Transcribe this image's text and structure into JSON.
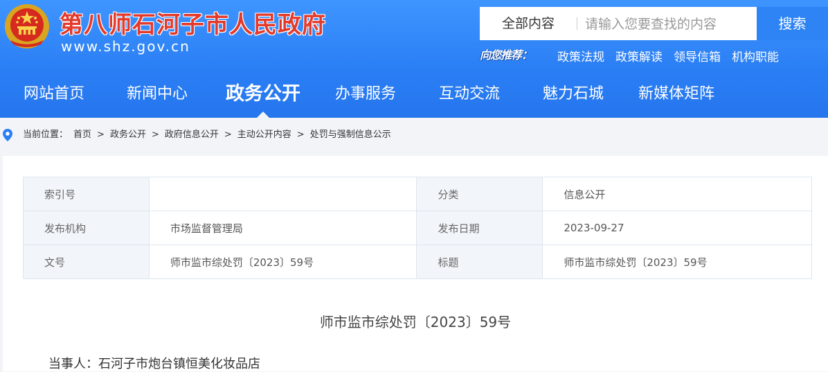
{
  "header": {
    "site_name": "第八师石河子市人民政府",
    "site_url": "www.shz.gov.cn",
    "search": {
      "scope": "全部内容",
      "placeholder": "请输入您要查找的内容",
      "button": "搜索"
    },
    "recommend_label": "向您推荐：",
    "quick_links": [
      "政策法规",
      "政策解读",
      "领导信箱",
      "机构职能"
    ]
  },
  "nav": {
    "items": [
      "网站首页",
      "新闻中心",
      "政务公开",
      "办事服务",
      "互动交流",
      "魅力石城",
      "新媒体矩阵"
    ],
    "active": "政务公开"
  },
  "breadcrumb": {
    "label": "当前位置：",
    "items": [
      "首页",
      "政务公开",
      "政府信息公开",
      "主动公开内容",
      "处罚与强制信息公示"
    ],
    "separator": ">"
  },
  "meta_table": {
    "rows": [
      [
        {
          "label": "索引号",
          "value": ""
        },
        {
          "label": "分类",
          "value": "信息公开"
        }
      ],
      [
        {
          "label": "发布机构",
          "value": "市场监督管理局"
        },
        {
          "label": "发布日期",
          "value": "2023-09-27"
        }
      ],
      [
        {
          "label": "文号",
          "value": "师市监市综处罚〔2023〕59号"
        },
        {
          "label": "标题",
          "value": "师市监市综处罚〔2023〕59号"
        }
      ]
    ]
  },
  "document": {
    "title": "师市监市综处罚〔2023〕59号",
    "party": "当事人：石河子市炮台镇恒美化妆品店"
  },
  "colors": {
    "header_blue": "#2a7ef4",
    "site_name_red": "#e43a2c",
    "search_button": "#2e84f4"
  }
}
